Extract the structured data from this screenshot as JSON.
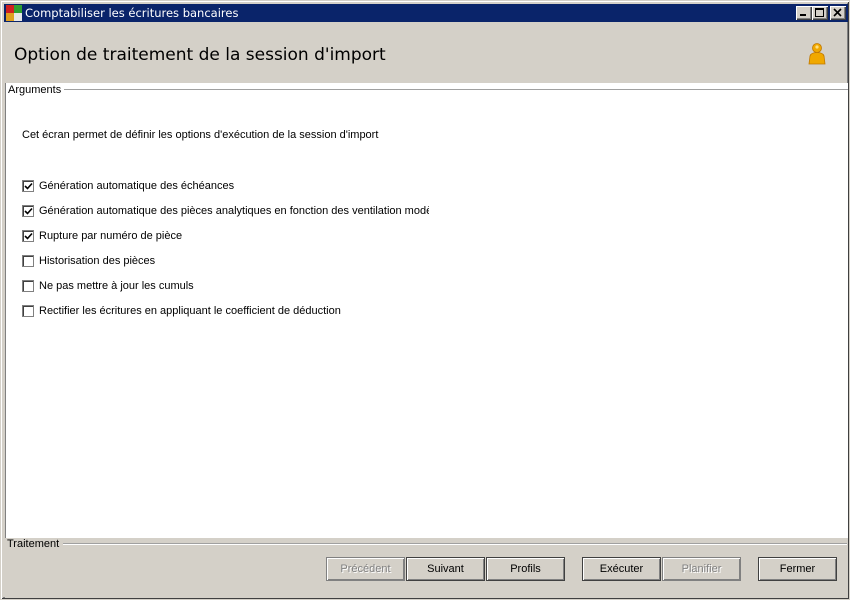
{
  "window": {
    "title": "Comptabiliser les écritures bancaires"
  },
  "header": {
    "title": "Option de traitement de la session d'import"
  },
  "arguments": {
    "group_label": "Arguments",
    "intro": "Cet écran permet de définir les options  d'exécution de la session  d'import",
    "options": [
      {
        "label": "Génération automatique des échéances",
        "checked": true
      },
      {
        "label": "Génération automatique des pièces analytiques en fonction des ventilation modèles",
        "checked": true
      },
      {
        "label": "Rupture par numéro de pièce",
        "checked": true
      },
      {
        "label": "Historisation des pièces",
        "checked": false
      },
      {
        "label": "Ne pas mettre à jour les cumuls",
        "checked": false
      },
      {
        "label": "Rectifier les écritures en appliquant le coefficient de déduction",
        "checked": false
      }
    ]
  },
  "traitement": {
    "group_label": "Traitement",
    "buttons": {
      "precedent": {
        "label": "Précédent",
        "enabled": false
      },
      "suivant": {
        "label": "Suivant",
        "enabled": true
      },
      "profils": {
        "label": "Profils",
        "enabled": true
      },
      "executer": {
        "label": "Exécuter",
        "enabled": true
      },
      "planifier": {
        "label": "Planifier",
        "enabled": false
      },
      "fermer": {
        "label": "Fermer",
        "enabled": true
      }
    }
  },
  "icons": {
    "app": "app-icon",
    "user": "user-icon",
    "minimize": "minimize-icon",
    "maximize": "maximize-icon",
    "close": "close-icon"
  },
  "colors": {
    "titlebar": "#0a246a",
    "user_icon": "#f0a800",
    "disabled_text": "#808080"
  }
}
